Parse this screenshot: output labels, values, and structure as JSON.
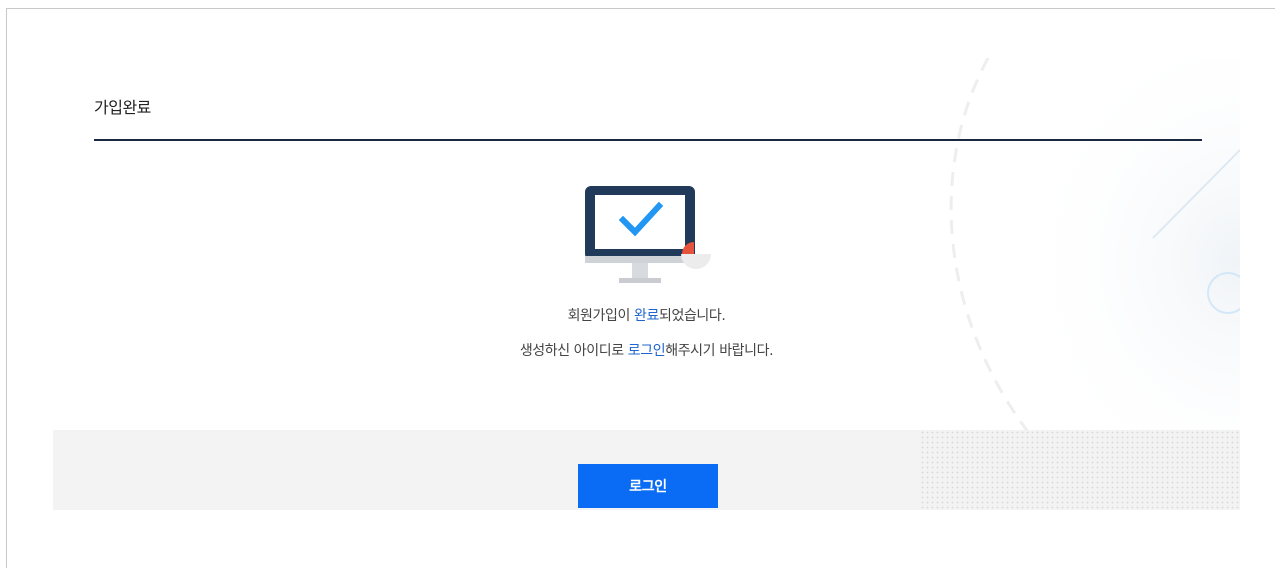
{
  "page": {
    "title": "가입완료"
  },
  "message": {
    "line1_pre": "회원가입이 ",
    "line1_highlight": "완료",
    "line1_post": "되었습니다.",
    "line2_pre": "생성하신 아이디로 ",
    "line2_highlight": "로그인",
    "line2_post": "해주시기 바랍니다."
  },
  "actions": {
    "login_label": "로그인"
  },
  "colors": {
    "accent": "#0a6cf5",
    "highlight_text": "#1f66d1",
    "title_rule": "#1a2740",
    "monitor_frame": "#213a59",
    "check": "#2196f3",
    "alert_dot": "#e5533c"
  },
  "icons": {
    "illustration": "monitor-check-icon"
  }
}
